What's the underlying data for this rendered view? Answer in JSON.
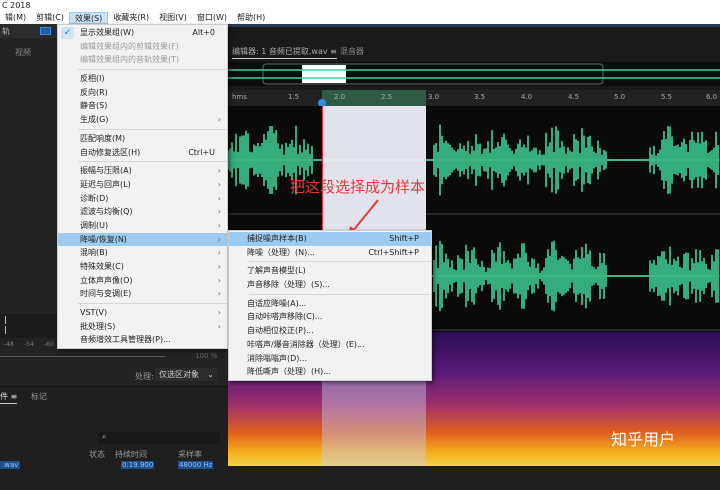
{
  "title": "C 2018",
  "menubar": [
    "辑(M)",
    "剪辑(C)",
    "效果(S)",
    "收藏夹(R)",
    "视图(V)",
    "窗口(W)",
    "帮助(H)"
  ],
  "left": {
    "tab1": "轨",
    "tab2": "视频",
    "meter_ticks": [
      "-48",
      "-54",
      "-60"
    ],
    "zoom_label": "100 %",
    "process_label": "处理:",
    "process_value": "仅选区对象",
    "files_tab": "件",
    "files_menu": "≡",
    "markers_tab": "标记",
    "search_icon": "⌕",
    "columns": [
      "状态",
      "持续时间",
      "采样率"
    ],
    "file_row": {
      "name": ".wav",
      "duration": "0:19.900",
      "rate": "48000 Hz"
    }
  },
  "editor": {
    "tab": "编辑器: 1 音频已提取.wav",
    "tab_menu": "≡",
    "mixer_tab": "混音器",
    "ruler": [
      "hms",
      "1.5",
      "2.0",
      "2.5",
      "3.0",
      "3.5",
      "4.0",
      "4.5",
      "5.0",
      "5.5",
      "6.0"
    ],
    "annotation": "把这段选择成为样本",
    "watermark": "知乎用户"
  },
  "effects_menu": [
    {
      "label": "显示效果组(W)",
      "shortcut": "Alt+0",
      "checked": true
    },
    {
      "label": "编辑效果组内的剪辑效果(F)",
      "disabled": true
    },
    {
      "label": "编辑效果组内的音轨效果(T)",
      "disabled": true
    },
    {
      "sep": true
    },
    {
      "label": "反相(I)"
    },
    {
      "label": "反向(R)"
    },
    {
      "label": "静音(S)"
    },
    {
      "label": "生成(G)",
      "submenu": true
    },
    {
      "sep": true
    },
    {
      "label": "匹配响度(M)"
    },
    {
      "label": "自动修复选区(H)",
      "shortcut": "Ctrl+U"
    },
    {
      "sep": true
    },
    {
      "label": "振幅与压限(A)",
      "submenu": true
    },
    {
      "label": "延迟与回声(L)",
      "submenu": true
    },
    {
      "label": "诊断(D)",
      "submenu": true
    },
    {
      "label": "滤波与均衡(Q)",
      "submenu": true
    },
    {
      "label": "调制(U)",
      "submenu": true
    },
    {
      "label": "降噪/恢复(N)",
      "submenu": true,
      "highlighted": true
    },
    {
      "label": "混响(B)",
      "submenu": true
    },
    {
      "label": "特殊效果(C)",
      "submenu": true
    },
    {
      "label": "立体声声像(O)",
      "submenu": true
    },
    {
      "label": "时间与变调(E)",
      "submenu": true
    },
    {
      "sep": true
    },
    {
      "label": "VST(V)",
      "submenu": true
    },
    {
      "label": "批处理(S)",
      "submenu": true
    },
    {
      "label": "音频增效工具管理器(P)..."
    }
  ],
  "noise_submenu": [
    {
      "label": "捕捉噪声样本(B)",
      "shortcut": "Shift+P",
      "highlighted": true
    },
    {
      "label": "降噪（处理）(N)...",
      "shortcut": "Ctrl+Shift+P"
    },
    {
      "sep": true
    },
    {
      "label": "了解声音模型(L)"
    },
    {
      "label": "声音移除（处理）(S)..."
    },
    {
      "sep": true
    },
    {
      "label": "自适应降噪(A)..."
    },
    {
      "label": "自动咔嗒声移除(C)..."
    },
    {
      "label": "自动相位校正(P)..."
    },
    {
      "label": "咔嗒声/爆音消除器（处理）(E)..."
    },
    {
      "label": "消除嗡嗡声(D)..."
    },
    {
      "label": "降低嘶声（处理）(H)..."
    }
  ],
  "colors": {
    "wave": "#3fd59a",
    "selection": "#eeeefa",
    "accent": "#2f8fe0",
    "annotation": "#e23a3a"
  }
}
